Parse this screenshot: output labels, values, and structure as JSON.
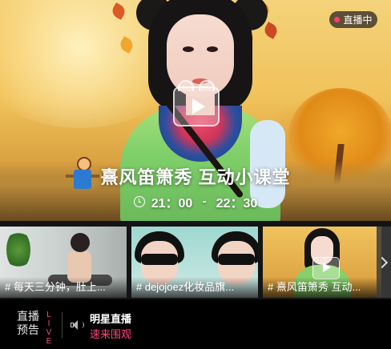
{
  "hero": {
    "badge": "直播中",
    "title": "熹风笛箫秀 互动小课堂",
    "time_start": "21：00",
    "time_sep": "-",
    "time_end": "22：30",
    "icons": [
      "clock-icon",
      "play-icon"
    ]
  },
  "thumbnails": [
    {
      "caption": "# 每天三分钟，肚上..."
    },
    {
      "caption": "# dejojoez化妆品旗..."
    },
    {
      "caption": "# 熹风笛箫秀 互动..."
    }
  ],
  "bottom_bar": {
    "label_line1": "直播",
    "label_line2": "预告",
    "live_vertical": [
      "L",
      "I",
      "V",
      "E"
    ],
    "title": "明星直播",
    "subtitle": "速来围观",
    "icons": [
      "speaker-icon"
    ]
  },
  "colors": {
    "accent_pink": "#ff4a7a",
    "live_dot": "#ff3e6c",
    "background": "#000000"
  }
}
